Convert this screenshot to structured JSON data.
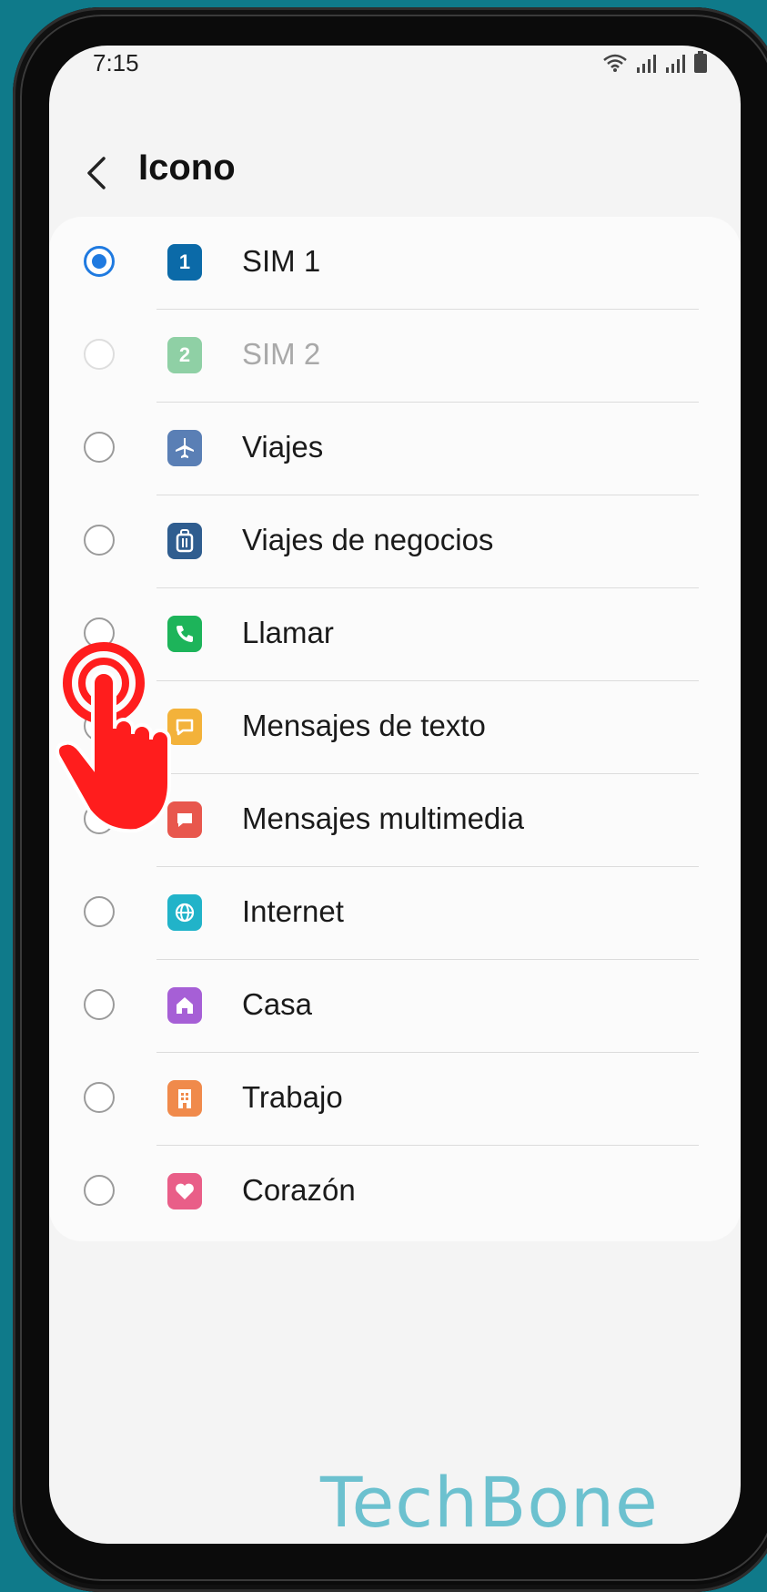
{
  "status_bar": {
    "time": "7:15"
  },
  "header": {
    "title": "Icono"
  },
  "options": [
    {
      "label": "SIM 1",
      "icon": "sim-1-icon",
      "icon_text": "1",
      "color": "#0b6aa8",
      "selected": true,
      "disabled": false
    },
    {
      "label": "SIM 2",
      "icon": "sim-2-icon",
      "icon_text": "2",
      "color": "#8fd0a5",
      "selected": false,
      "disabled": true
    },
    {
      "label": "Viajes",
      "icon": "airplane-icon",
      "color": "#5a7fb5",
      "selected": false,
      "disabled": false
    },
    {
      "label": "Viajes de negocios",
      "icon": "luggage-icon",
      "color": "#2f5d8f",
      "selected": false,
      "disabled": false
    },
    {
      "label": "Llamar",
      "icon": "phone-icon",
      "color": "#1db45a",
      "selected": false,
      "disabled": false
    },
    {
      "label": "Mensajes de texto",
      "icon": "message-icon",
      "color": "#f3b23a",
      "selected": false,
      "disabled": false
    },
    {
      "label": "Mensajes multimedia",
      "icon": "multimedia-message-icon",
      "color": "#e8574d",
      "selected": false,
      "disabled": false
    },
    {
      "label": "Internet",
      "icon": "globe-icon",
      "color": "#21b3c9",
      "selected": false,
      "disabled": false
    },
    {
      "label": "Casa",
      "icon": "home-icon",
      "color": "#a65fd6",
      "selected": false,
      "disabled": false
    },
    {
      "label": "Trabajo",
      "icon": "building-icon",
      "color": "#f08a4b",
      "selected": false,
      "disabled": false
    },
    {
      "label": "Corazón",
      "icon": "heart-icon",
      "color": "#e95e88",
      "selected": false,
      "disabled": false
    }
  ],
  "watermark": "TechBone"
}
